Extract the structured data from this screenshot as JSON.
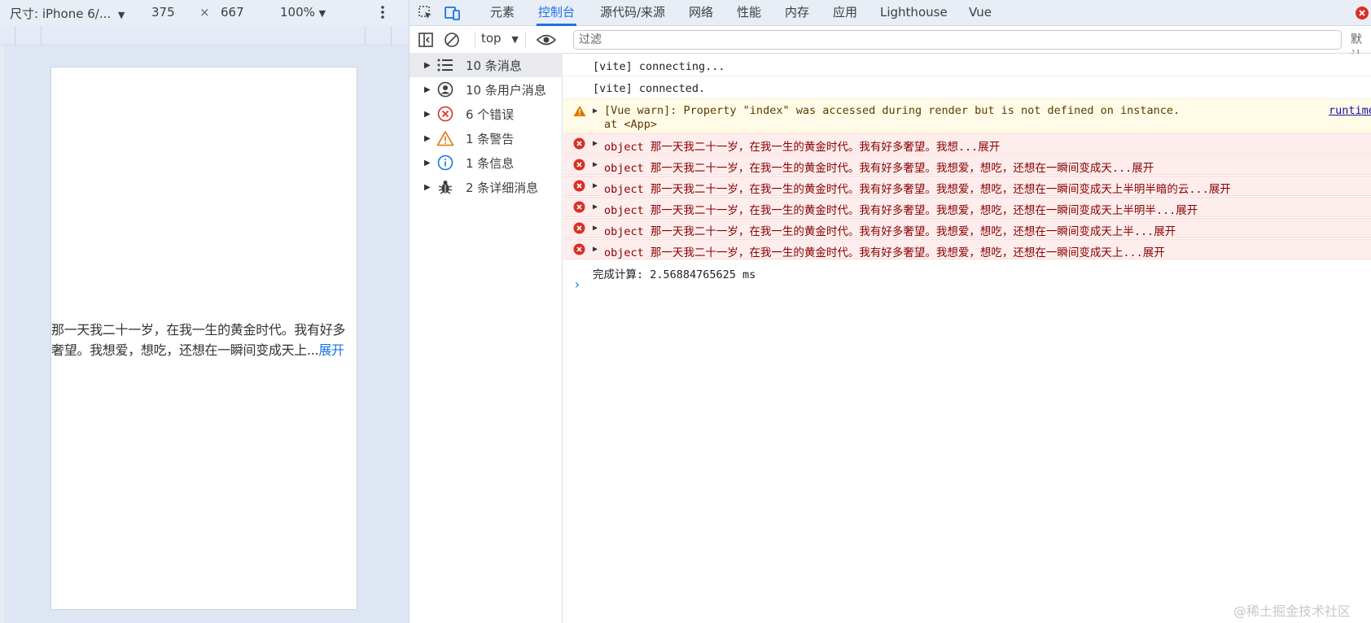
{
  "device_toolbar": {
    "dimensions_label": "尺寸: iPhone 6/...",
    "width": "375",
    "times": "×",
    "height": "667",
    "zoom": "100%",
    "more_icon": "more-vertical-icon"
  },
  "device_screen": {
    "text": "那一天我二十一岁，在我一生的黄金时代。我有好多奢望。我想爱，想吃，还想在一瞬间变成天上...",
    "expand_label": "展开"
  },
  "devtools_tabs": [
    {
      "label": "元素"
    },
    {
      "label": "控制台",
      "active": true
    },
    {
      "label": "源代码/来源"
    },
    {
      "label": "网络"
    },
    {
      "label": "性能"
    },
    {
      "label": "内存"
    },
    {
      "label": "应用"
    },
    {
      "label": "Lighthouse"
    },
    {
      "label": "Vue"
    }
  ],
  "console_toolbar": {
    "context": "top",
    "filter_placeholder": "过滤",
    "default_levels": "默认"
  },
  "sidebar": {
    "items": [
      {
        "label": "10 条消息",
        "icon": "list-icon"
      },
      {
        "label": "10 条用户消息",
        "icon": "user-icon"
      },
      {
        "label": "6 个错误",
        "icon": "error-icon"
      },
      {
        "label": "1 条警告",
        "icon": "warning-icon"
      },
      {
        "label": "1 条信息",
        "icon": "info-icon"
      },
      {
        "label": "2 条详细消息",
        "icon": "bug-icon"
      }
    ]
  },
  "console": {
    "messages": [
      {
        "type": "log",
        "text": "[vite] connecting..."
      },
      {
        "type": "log",
        "text": "[vite] connected."
      },
      {
        "type": "warn",
        "text": "[Vue warn]: Property \"index\" was accessed during render but is not defined on instance.",
        "detail": "at <App>",
        "link": "runtime"
      },
      {
        "type": "error",
        "text": "object 那一天我二十一岁，在我一生的黄金时代。我有好多奢望。我想...展开"
      },
      {
        "type": "error",
        "text": "object 那一天我二十一岁，在我一生的黄金时代。我有好多奢望。我想爱，想吃，还想在一瞬间变成天...展开"
      },
      {
        "type": "error",
        "text": "object 那一天我二十一岁，在我一生的黄金时代。我有好多奢望。我想爱，想吃，还想在一瞬间变成天上半明半暗的云...展开"
      },
      {
        "type": "error",
        "text": "object 那一天我二十一岁，在我一生的黄金时代。我有好多奢望。我想爱，想吃，还想在一瞬间变成天上半明半...展开"
      },
      {
        "type": "error",
        "text": "object 那一天我二十一岁，在我一生的黄金时代。我有好多奢望。我想爱，想吃，还想在一瞬间变成天上半...展开"
      },
      {
        "type": "error",
        "text": "object 那一天我二十一岁，在我一生的黄金时代。我有好多奢望。我想爱，想吃，还想在一瞬间变成天上...展开"
      },
      {
        "type": "log",
        "text": "完成计算: 2.56884765625 ms"
      }
    ]
  },
  "watermark": "@稀土掘金技术社区",
  "colors": {
    "accent": "#1a73e8",
    "error": "#d93025",
    "warning": "#e37400"
  }
}
